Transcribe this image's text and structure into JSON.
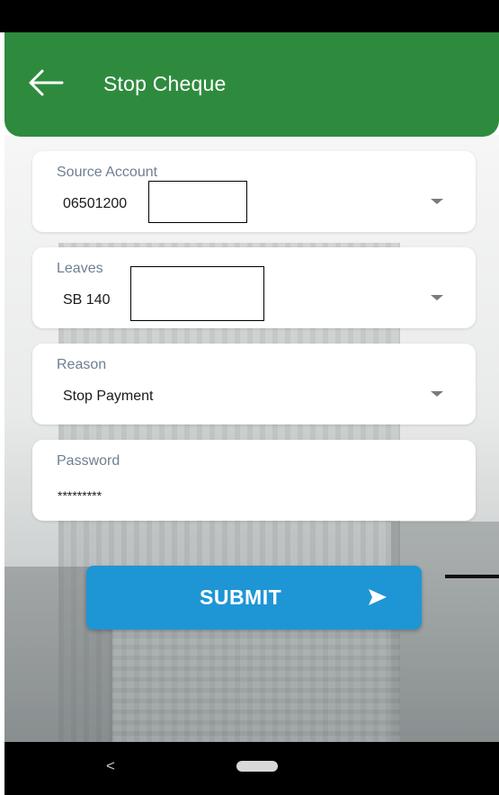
{
  "header": {
    "title": "Stop Cheque",
    "back_icon": "arrow-left-icon"
  },
  "form": {
    "source_account": {
      "label": "Source Account",
      "value": "06501200"
    },
    "leaves": {
      "label": "Leaves",
      "value": "SB 140"
    },
    "reason": {
      "label": "Reason",
      "value": "Stop Payment"
    },
    "password": {
      "label": "Password",
      "value": "*********"
    }
  },
  "submit": {
    "label": "SUBMIT",
    "icon": "send-arrow-icon"
  },
  "nav": {
    "back_glyph": "<",
    "home_icon": "home-pill-icon"
  },
  "colors": {
    "app_bar": "#2e8b3e",
    "submit_button": "#1e96d5"
  }
}
